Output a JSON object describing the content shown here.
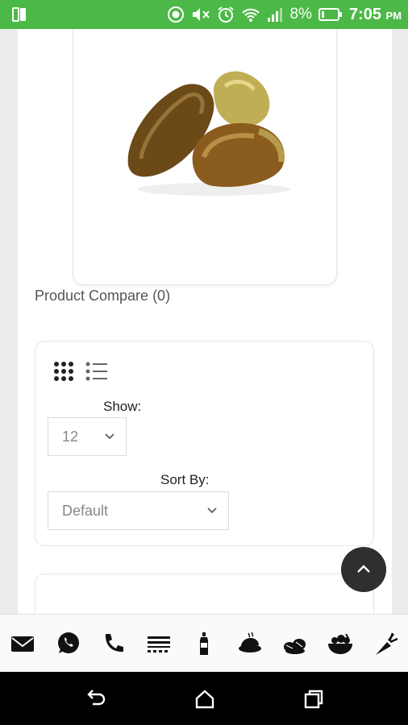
{
  "status_bar": {
    "battery_percent": "8%",
    "time": "7:05",
    "ampm": "PM"
  },
  "product": {
    "image": "dates-fruit-image"
  },
  "compare": {
    "label": "Product Compare (0)"
  },
  "toolbar": {
    "show_label": "Show:",
    "show_value": "12",
    "sort_label": "Sort By:",
    "sort_value": "Default",
    "view_modes": [
      "grid-view-icon",
      "list-view-icon"
    ]
  },
  "bottom_bar": {
    "icons": [
      "mail-icon",
      "whatsapp-icon",
      "phone-icon",
      "grocery-category-icon",
      "bottle-category-icon",
      "poultry-category-icon",
      "dry-fruits-category-icon",
      "salad-category-icon",
      "vegetables-category-icon"
    ]
  },
  "colors": {
    "status_bar": "#4cb847",
    "scroll_button": "#2f2f2f"
  }
}
